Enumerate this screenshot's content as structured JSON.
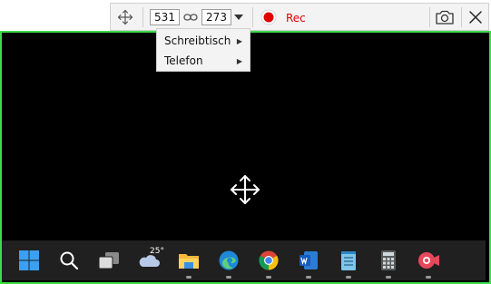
{
  "toolbar": {
    "width_value": "531",
    "height_value": "273",
    "rec_label": "Rec"
  },
  "menu": {
    "items": [
      {
        "label": "Schreibtisch"
      },
      {
        "label": "Telefon"
      }
    ]
  },
  "taskbar": {
    "weather_temp": "25°",
    "icons": [
      "windows-start-icon",
      "search-icon",
      "task-view-icon",
      "weather-icon",
      "file-explorer-icon",
      "edge-icon",
      "chrome-icon",
      "word-icon",
      "notepad-icon",
      "calculator-icon",
      "screen-recorder-icon"
    ]
  },
  "colors": {
    "frame": "#3ddc4a",
    "rec": "#e00000",
    "taskbar": "#202020"
  }
}
